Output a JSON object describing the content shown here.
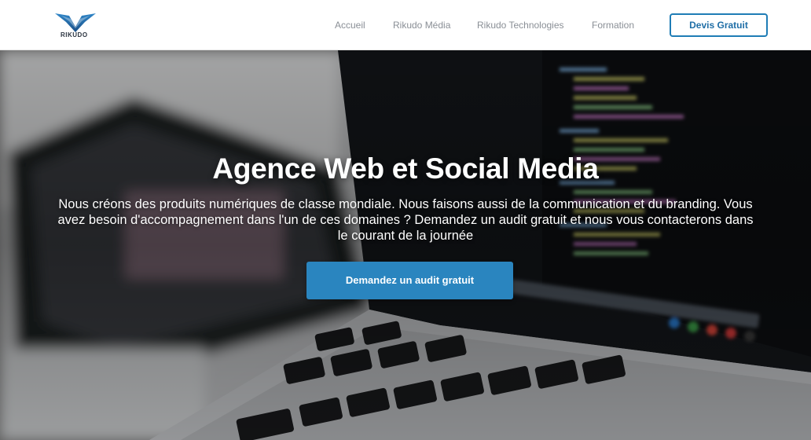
{
  "brand": {
    "name": "RIKUDO",
    "logo_icon": "wing-logo-icon",
    "accent": "#2a85bf"
  },
  "nav": {
    "items": [
      {
        "label": "Accueil"
      },
      {
        "label": "Rikudo Média"
      },
      {
        "label": "Rikudo Technologies"
      },
      {
        "label": "Formation"
      }
    ],
    "cta_label": "Devis Gratuit"
  },
  "hero": {
    "title": "Agence Web et Social Media",
    "description": "Nous créons des produits numériques de classe mondiale. Nous faisons aussi de la communication et du branding. Vous avez besoin d'accompagnement dans l'un de ces domaines ? Demandez un audit gratuit et nous vous contacterons dans le courant de la journée",
    "button_label": "Demandez un audit gratuit",
    "background_image": "laptop-code-photo"
  }
}
